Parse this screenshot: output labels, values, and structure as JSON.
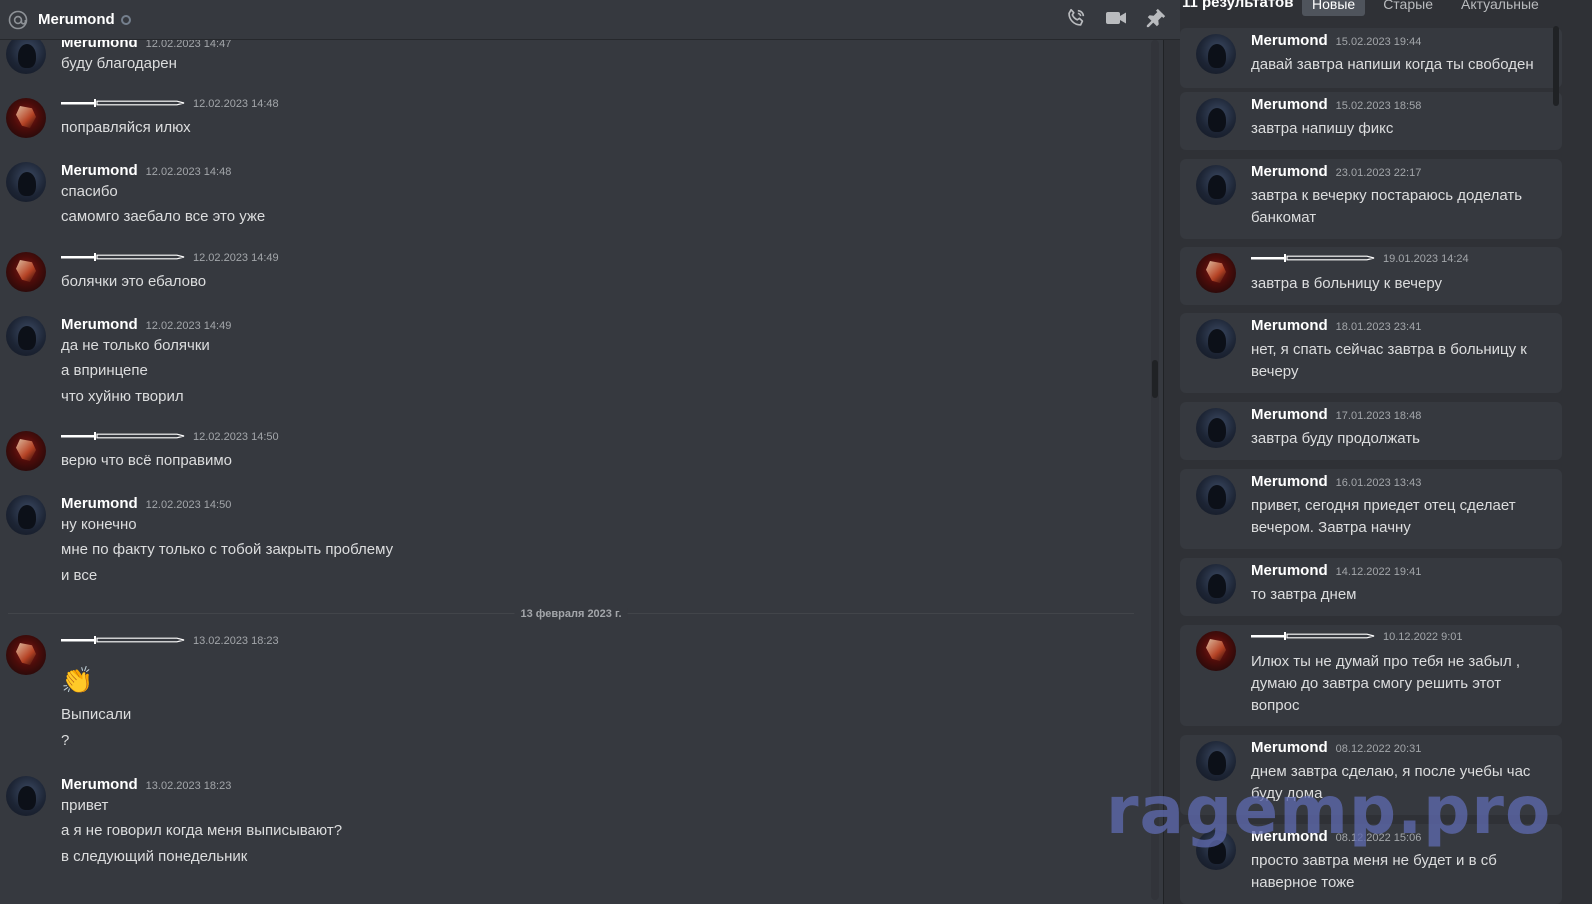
{
  "topbar": {
    "channel_name": "Merumond",
    "icons": [
      "at-icon",
      "status-offline-icon",
      "call-icon",
      "video-icon",
      "pin-icon"
    ]
  },
  "chat": {
    "groups": [
      {
        "author": "Merumond",
        "avatar": "dark",
        "timestamp": "12.02.2023 14:47",
        "lines": [
          "буду благодарен"
        ]
      },
      {
        "author": "",
        "avatar": "red",
        "name_graphic": "sword-nickname",
        "timestamp": "12.02.2023 14:48",
        "lines": [
          "поправляйся илюх"
        ]
      },
      {
        "author": "Merumond",
        "avatar": "dark",
        "timestamp": "12.02.2023 14:48",
        "lines": [
          "спасибо",
          "самомго заебало все это уже"
        ]
      },
      {
        "author": "",
        "avatar": "red",
        "name_graphic": "sword-nickname",
        "timestamp": "12.02.2023 14:49",
        "lines": [
          "болячки это ебалово"
        ]
      },
      {
        "author": "Merumond",
        "avatar": "dark",
        "timestamp": "12.02.2023 14:49",
        "lines": [
          "да не только болячки",
          "а впринцепе",
          "что хуйню творил"
        ]
      },
      {
        "author": "",
        "avatar": "red",
        "name_graphic": "sword-nickname",
        "timestamp": "12.02.2023 14:50",
        "lines": [
          "верю что всё поправимо"
        ]
      },
      {
        "author": "Merumond",
        "avatar": "dark",
        "timestamp": "12.02.2023 14:50",
        "lines": [
          "ну конечно",
          "мне по факту только с тобой закрыть проблему",
          "и все"
        ]
      },
      {
        "author": "",
        "avatar": "red",
        "name_graphic": "sword-nickname",
        "timestamp": "13.02.2023 18:23",
        "emoji": "👏",
        "lines": [
          "Выписали",
          "?"
        ]
      },
      {
        "author": "Merumond",
        "avatar": "dark",
        "timestamp": "13.02.2023 18:23",
        "lines": [
          "привет",
          "а я не говорил когда меня выписывают?",
          "в следующий понедельник"
        ]
      }
    ],
    "date_divider": "13 февраля 2023 г."
  },
  "search_panel": {
    "result_count": "11 результатов",
    "sort_tabs": [
      {
        "label": "Новые",
        "active": true
      },
      {
        "label": "Старые",
        "active": false
      },
      {
        "label": "Актуальные",
        "active": false
      }
    ],
    "results": [
      {
        "author": "Merumond",
        "avatar": "dark",
        "timestamp": "15.02.2023 19:44",
        "text": "давай завтра напиши когда ты свободен"
      },
      {
        "author": "Merumond",
        "avatar": "dark",
        "timestamp": "15.02.2023 18:58",
        "text": "завтра напишу фикс"
      },
      {
        "author": "Merumond",
        "avatar": "dark",
        "timestamp": "23.01.2023 22:17",
        "text": "завтра к вечерку постараюсь доделать банкомат"
      },
      {
        "author": "",
        "avatar": "red",
        "name_graphic": "sword-nickname",
        "timestamp": "19.01.2023 14:24",
        "text": "завтра в больницу к вечеру"
      },
      {
        "author": "Merumond",
        "avatar": "dark",
        "timestamp": "18.01.2023 23:41",
        "text": "нет, я спать сейчас завтра в больницу к вечеру"
      },
      {
        "author": "Merumond",
        "avatar": "dark",
        "timestamp": "17.01.2023 18:48",
        "text": "завтра буду продолжать"
      },
      {
        "author": "Merumond",
        "avatar": "dark",
        "timestamp": "16.01.2023 13:43",
        "text": "привет, сегодня приедет отец сделает вечером. Завтра начну"
      },
      {
        "author": "Merumond",
        "avatar": "dark",
        "timestamp": "14.12.2022 19:41",
        "text": "то завтра днем"
      },
      {
        "author": "",
        "avatar": "red",
        "name_graphic": "sword-nickname",
        "timestamp": "10.12.2022 9:01",
        "text": "Илюх ты не думай про тебя не забыл , думаю до завтра смогу решить этот вопрос"
      },
      {
        "author": "Merumond",
        "avatar": "dark",
        "timestamp": "08.12.2022 20:31",
        "text": "днем завтра сделаю, я после учебы час буду дома"
      },
      {
        "author": "Merumond",
        "avatar": "dark",
        "timestamp": "08.12.2022 15:06",
        "text": "просто завтра меня не будет и в сб наверное тоже"
      }
    ]
  },
  "watermark": "ragemp.pro",
  "colors": {
    "chat_bg": "#36393f",
    "panel_bg": "#2f3136",
    "card_bg": "#36393f",
    "text": "#dcddde",
    "timestamp": "#a3a6aa",
    "watermark": "#5d68aa"
  }
}
